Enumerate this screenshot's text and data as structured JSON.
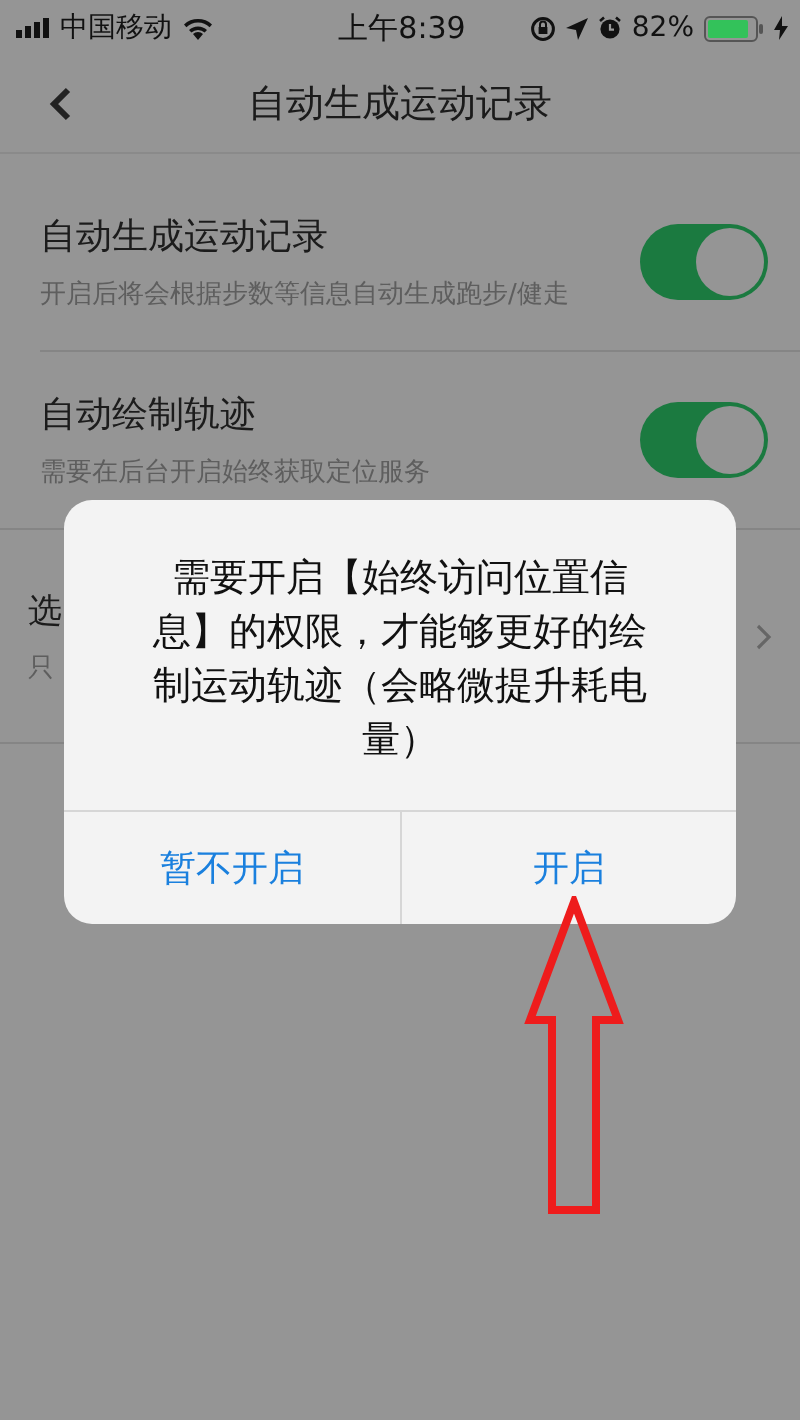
{
  "status_bar": {
    "carrier": "中国移动",
    "time": "上午8:39",
    "battery": "82%"
  },
  "nav": {
    "title": "自动生成运动记录"
  },
  "settings": [
    {
      "kind": "toggle",
      "title": "自动生成运动记录",
      "subtitle": "开启后将会根据步数等信息自动生成跑步/健走",
      "on": true
    },
    {
      "kind": "toggle",
      "title": "自动绘制轨迹",
      "subtitle": "需要在后台开启始终获取定位服务",
      "on": true
    },
    {
      "kind": "link",
      "title": "选",
      "subtitle": "只"
    }
  ],
  "dialog": {
    "message": "需要开启【始终访问位置信息】的权限，才能够更好的绘制运动轨迹（会略微提升耗电量）",
    "buttons": [
      {
        "label": "暂不开启"
      },
      {
        "label": "开启"
      }
    ]
  }
}
